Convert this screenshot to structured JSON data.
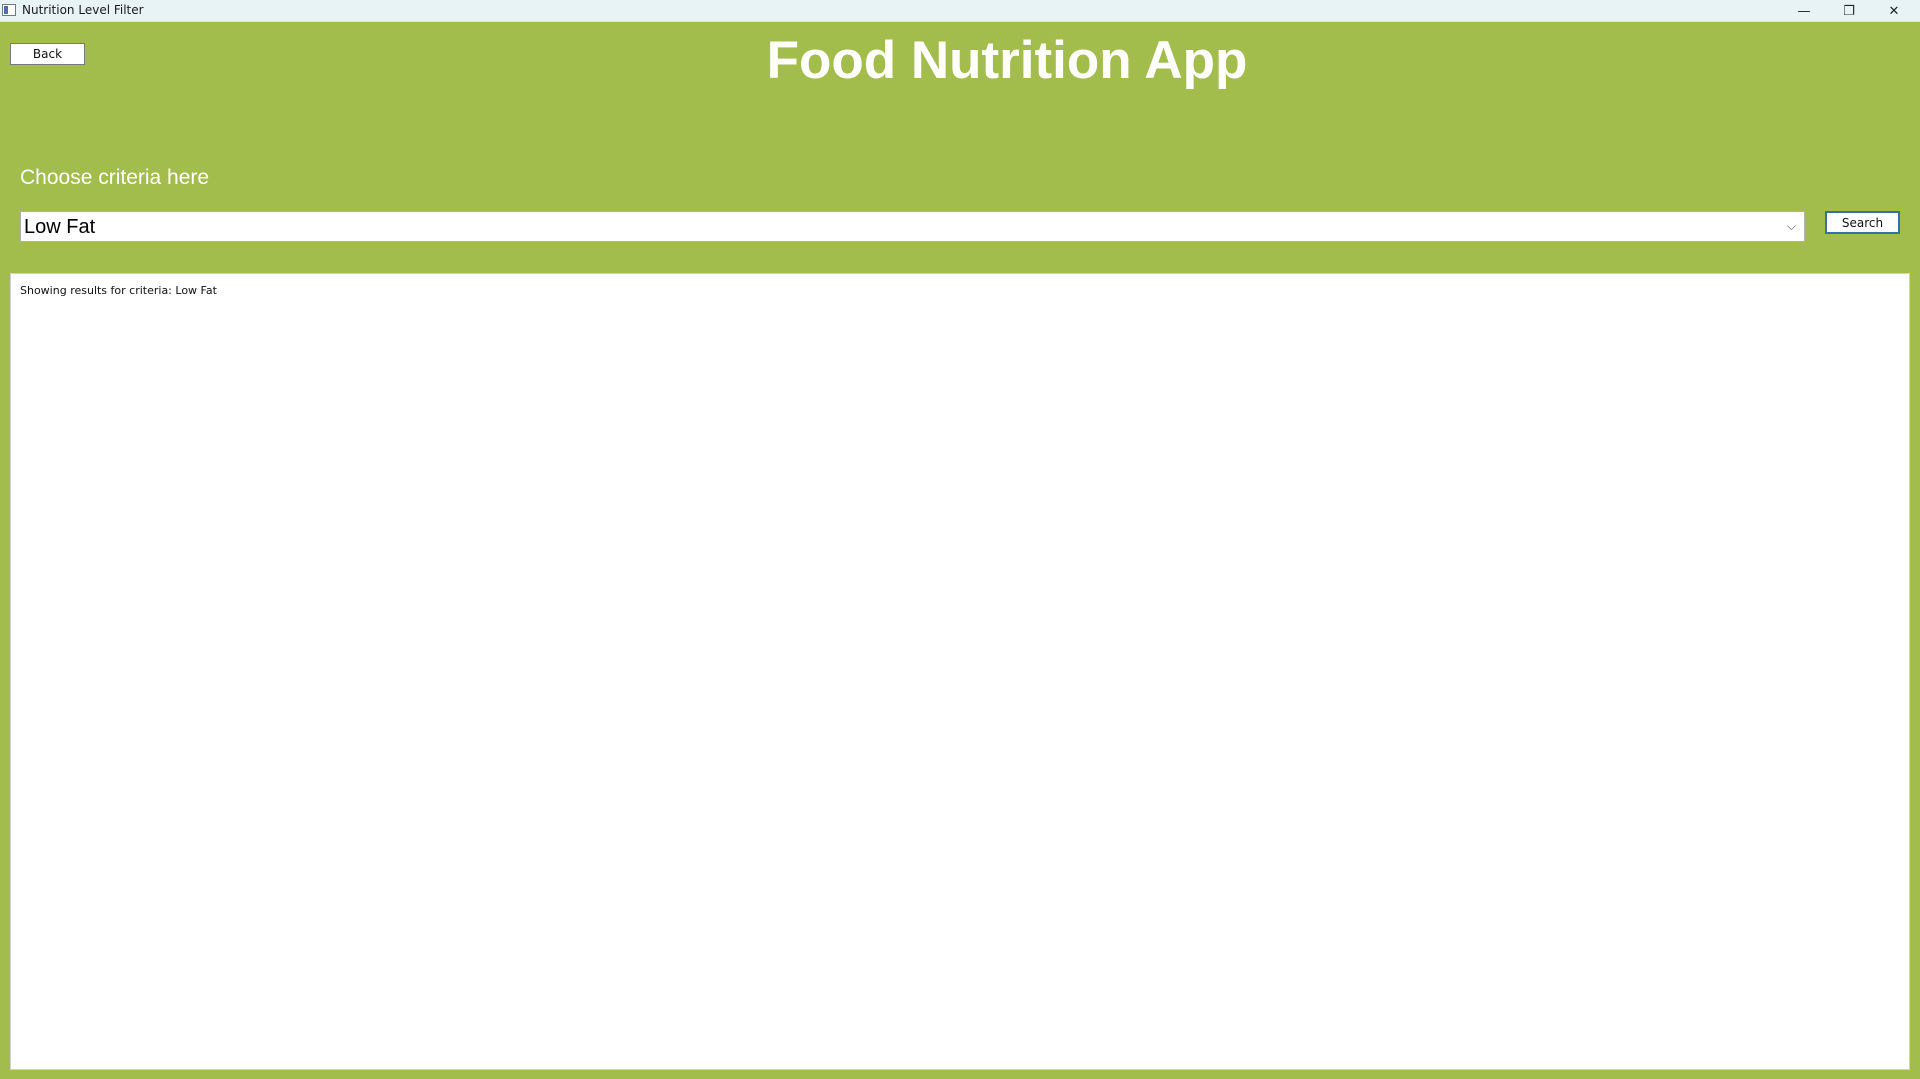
{
  "window": {
    "title": "Nutrition Level Filter",
    "controls": {
      "minimize": "—",
      "maximize": "❐",
      "close": "✕"
    }
  },
  "toolbar": {
    "back_label": "Back"
  },
  "header": {
    "app_title": "Food Nutrition App"
  },
  "criteria": {
    "label": "Choose criteria here",
    "selected": "Low Fat",
    "chevron": "⌵",
    "search_label": "Search"
  },
  "results": {
    "status_text": "Showing results for criteria: Low Fat"
  },
  "colors": {
    "background": "#a2bd4b",
    "titlebar": "#e8f3f5",
    "text_light": "#ffffff"
  }
}
